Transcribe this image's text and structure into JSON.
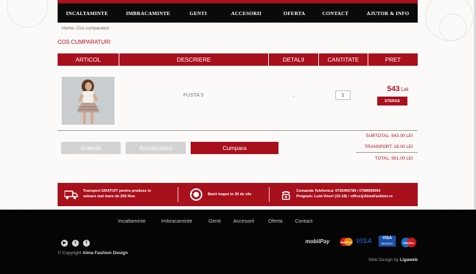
{
  "nav": {
    "items": [
      "INCALTAMINTE",
      "IMBRACAMINTE",
      "GENTI",
      "ACCESORII",
      "OFERTA",
      "CONTACT",
      "AJUTOR & INFO"
    ]
  },
  "breadcrumb": {
    "home": "Home",
    "separator": "›",
    "current": "Cos cumparaturi"
  },
  "page_title": "COS CUMPARATURI",
  "table": {
    "headers": [
      "ARTICOL",
      "DESCRIERE",
      "DETALII",
      "CANTITATE",
      "PRET"
    ]
  },
  "cart": {
    "item": {
      "description": "FUSTA 5",
      "details": "-",
      "quantity": "1",
      "price": "543",
      "currency": "Lei",
      "delete_label": "STERGE"
    }
  },
  "buttons": {
    "clear": "Goleste",
    "update": "Actualizeaza",
    "buy": "Cumpara"
  },
  "totals": {
    "subtotal": "SUBTOTAL: 543.00 LEI",
    "transport": "TRANSPORT: 18.00 LEI",
    "total": "TOTAL: 561.00 LEI"
  },
  "infobar": {
    "shipping_line1": "Transport GRATUIT pentru produse in",
    "shipping_line2": "valoare mai mare de 250 Ron",
    "refund": "Banii inapoi in 30 de zile",
    "phone_line1": "Comanda Telefonica: 0726456789 / 0788999000",
    "phone_line2": "Program: Luni-Vineri (10-18) • office@AlmaFashion.ro"
  },
  "footer": {
    "nav": [
      "Incaltaminte",
      "Imbracaminte",
      "Genti",
      "Accesorii",
      "Oferta",
      "Contact"
    ],
    "copyright_prefix": "© Copyright",
    "copyright_brand": "Alma Fashion Design",
    "credit_prefix": "Web Design by",
    "credit_brand": "Ligaweb",
    "payment": {
      "mobilpay": "mobilPay",
      "mastercard": "MasterCard",
      "visa": "VISA",
      "visa_electron_top": "VISA",
      "visa_electron_bottom": "Electron",
      "maestro": "Maestro"
    }
  },
  "colors": {
    "brand_red": "#a8101b",
    "nav_black": "#0a0a0a",
    "footer_black": "#050505"
  }
}
